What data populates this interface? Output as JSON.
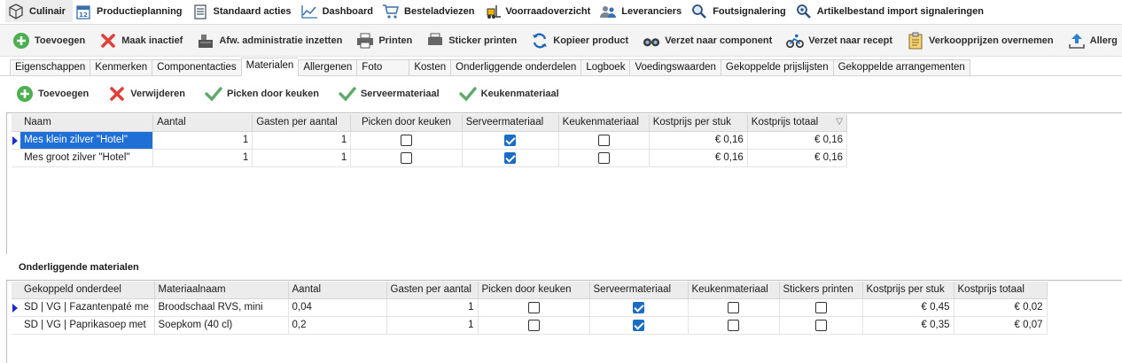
{
  "topnav": [
    {
      "label": "Culinair",
      "icon": "cube-icon",
      "active": true
    },
    {
      "label": "Productieplanning",
      "icon": "calendar-icon"
    },
    {
      "label": "Standaard acties",
      "icon": "checklist-icon"
    },
    {
      "label": "Dashboard",
      "icon": "line-chart-icon"
    },
    {
      "label": "Besteladviezen",
      "icon": "shopping-cart-icon"
    },
    {
      "label": "Voorraadoverzicht",
      "icon": "forklift-icon"
    },
    {
      "label": "Leveranciers",
      "icon": "people-icon"
    },
    {
      "label": "Foutsignalering",
      "icon": "magnifier-icon"
    },
    {
      "label": "Artikelbestand import signaleringen",
      "icon": "magnifier-gear-icon"
    }
  ],
  "toolbar": [
    {
      "label": "Toevoegen",
      "icon": "plus-circle-icon"
    },
    {
      "label": "Maak inactief",
      "icon": "red-x-icon"
    },
    {
      "label": "Afw. administratie inzetten",
      "icon": "cash-register-icon"
    },
    {
      "label": "Printen",
      "icon": "printer-icon"
    },
    {
      "label": "Sticker printen",
      "icon": "label-printer-icon"
    },
    {
      "label": "Kopieer product",
      "icon": "refresh-icon"
    },
    {
      "label": "Verzet naar component",
      "icon": "binoculars-icon"
    },
    {
      "label": "Verzet naar recept",
      "icon": "cyclist-icon"
    },
    {
      "label": "Verkoopprijzen overnemen",
      "icon": "clipboard-icon"
    },
    {
      "label": "Allerg",
      "icon": "upload-icon"
    }
  ],
  "tabs": [
    {
      "label": "Eigenschappen"
    },
    {
      "label": "Kenmerken"
    },
    {
      "label": "Componentacties"
    },
    {
      "label": "Materialen",
      "active": true
    },
    {
      "label": "Allergenen"
    },
    {
      "label": "Foto"
    },
    {
      "label": "Kosten"
    },
    {
      "label": "Onderliggende onderdelen"
    },
    {
      "label": "Logboek"
    },
    {
      "label": "Voedingswaarden"
    },
    {
      "label": "Gekoppelde prijslijsten"
    },
    {
      "label": "Gekoppelde arrangementen"
    }
  ],
  "subtoolbar": [
    {
      "label": "Toevoegen",
      "icon": "plus-circle-icon"
    },
    {
      "label": "Verwijderen",
      "icon": "red-x-icon"
    },
    {
      "label": "Picken door keuken",
      "icon": "green-check-icon"
    },
    {
      "label": "Serveermateriaal",
      "icon": "green-check-icon"
    },
    {
      "label": "Keukenmateriaal",
      "icon": "green-check-icon"
    }
  ],
  "materials_grid": {
    "columns": [
      "Naam",
      "Aantal",
      "Gasten per aantal",
      "Picken door keuken",
      "Serveermateriaal",
      "Keukenmateriaal",
      "Kostprijs per stuk",
      "Kostprijs totaal"
    ],
    "rows": [
      {
        "naam": "Mes klein zilver \"Hotel\"",
        "aantal": "1",
        "gasten": "1",
        "picken": false,
        "serveer": true,
        "keuken": false,
        "prijs_stuk": "€ 0,16",
        "prijs_totaal": "€ 0,16",
        "selected": true
      },
      {
        "naam": "Mes groot zilver \"Hotel\"",
        "aantal": "1",
        "gasten": "1",
        "picken": false,
        "serveer": true,
        "keuken": false,
        "prijs_stuk": "€ 0,16",
        "prijs_totaal": "€ 0,16",
        "selected": false
      }
    ]
  },
  "underlying": {
    "title": "Onderliggende materialen",
    "columns": [
      "Gekoppeld onderdeel",
      "Materiaalnaam",
      "Aantal",
      "Gasten per aantal",
      "Picken door keuken",
      "Serveermateriaal",
      "Keukenmateriaal",
      "Stickers printen",
      "Kostprijs per stuk",
      "Kostprijs totaal"
    ],
    "rows": [
      {
        "onderdeel": "SD | VG | Fazantenpaté me",
        "materiaal": "Broodschaal RVS, mini",
        "aantal": "0,04",
        "gasten": "1",
        "picken": false,
        "serveer": true,
        "keuken": false,
        "stickers": false,
        "prijs_stuk": "€ 0,45",
        "prijs_totaal": "€ 0,02"
      },
      {
        "onderdeel": "SD | VG | Paprikasoep met",
        "materiaal": "Soepkom (40 cl)",
        "aantal": "0,2",
        "gasten": "1",
        "picken": false,
        "serveer": true,
        "keuken": false,
        "stickers": false,
        "prijs_stuk": "€ 0,35",
        "prijs_totaal": "€ 0,07"
      }
    ]
  }
}
